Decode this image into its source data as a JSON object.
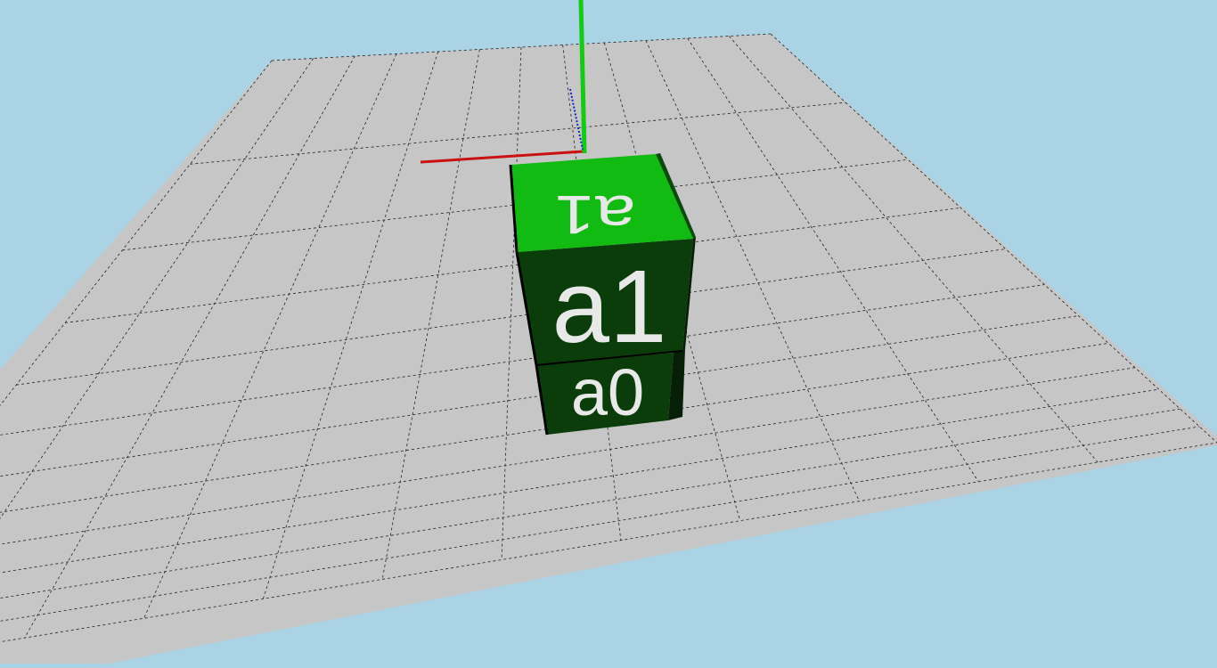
{
  "scene": {
    "background_color": "#aad4e6",
    "ground_color": "#c6c6c6",
    "grid_line_color": "#222222",
    "axes": {
      "x_color": "#cc1111",
      "y_color": "#11cc11",
      "z_color": "#1122cc"
    },
    "blocks": [
      {
        "id": "a0",
        "label": "a0",
        "face_color": "#0a3d0a"
      },
      {
        "id": "a1",
        "label": "a1",
        "face_color": "#0a3d0a",
        "top_label": "a1",
        "top_color": "#11bb11"
      }
    ]
  }
}
